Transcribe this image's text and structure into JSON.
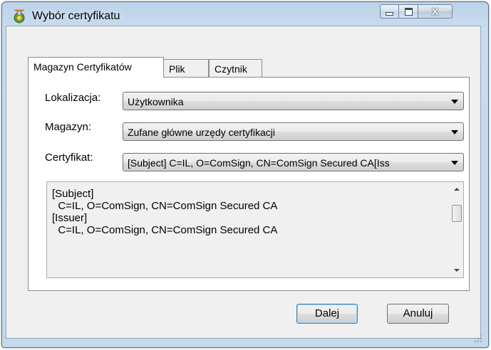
{
  "window": {
    "title": "Wybór certyfikatu",
    "icon": "certificate-icon",
    "controls": {
      "minimize": "minimize-icon",
      "maximize": "maximize-icon",
      "close": "X"
    }
  },
  "tabs": [
    {
      "label": "Magazyn Certyfikatów",
      "active": true
    },
    {
      "label": "Plik",
      "active": false
    },
    {
      "label": "Czytnik",
      "active": false
    }
  ],
  "form": {
    "location_label": "Lokalizacja:",
    "location_value": "Użytkownika",
    "store_label": "Magazyn:",
    "store_value": "Zufane główne urzędy certyfikacji",
    "cert_label": "Certyfikat:",
    "cert_value": "[Subject]  C=IL, O=ComSign, CN=ComSign Secured CA[Iss"
  },
  "details": {
    "lines": [
      "[Subject]",
      "  C=IL, O=ComSign, CN=ComSign Secured CA",
      "",
      "[Issuer]",
      "  C=IL, O=ComSign, CN=ComSign Secured CA"
    ]
  },
  "buttons": {
    "next": "Dalej",
    "cancel": "Anuluj"
  },
  "colors": {
    "title_bar": "#bcd3e9",
    "dialog_bg": "#f0f0f0",
    "default_button_border": "#3c7fb1"
  }
}
